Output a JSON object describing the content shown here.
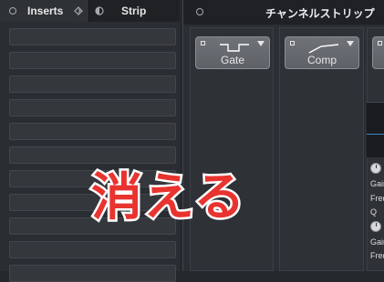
{
  "left_panel": {
    "tabs": [
      {
        "label": "Inserts"
      },
      {
        "label": "Strip"
      }
    ],
    "slot_count": 12
  },
  "right_panel": {
    "title": "チャンネルストリップ",
    "modules": [
      {
        "label": "Gate",
        "icon": "gate-curve-icon"
      },
      {
        "label": "Comp",
        "icon": "comp-curve-icon"
      },
      {
        "label": "",
        "icon": "partial-module"
      }
    ],
    "eq_params": [
      "Gain",
      "Freq",
      "Q"
    ],
    "eq_params_2": [
      "Gain",
      "Freq"
    ]
  },
  "overlay": {
    "text": "消える",
    "color": "#e8332f"
  }
}
